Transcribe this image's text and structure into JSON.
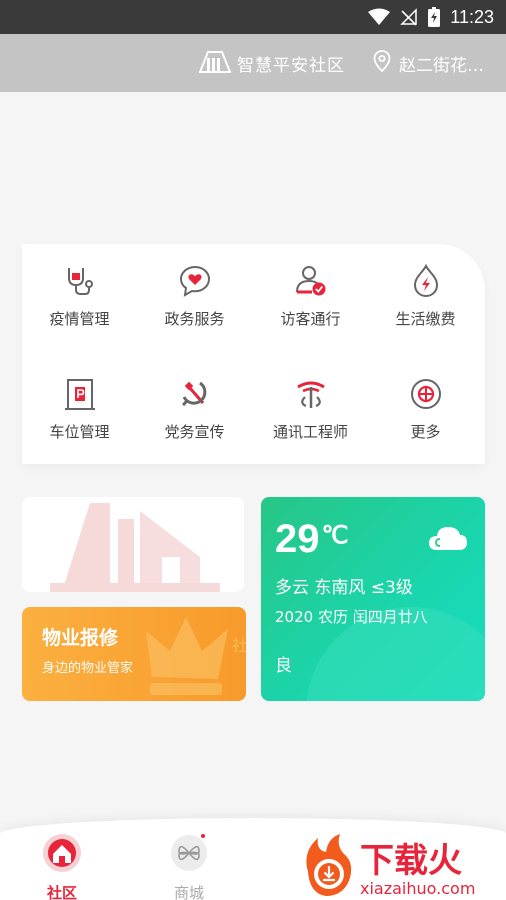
{
  "status_bar": {
    "time": "11:23"
  },
  "header": {
    "brand": "智慧平安社区",
    "location": "赵二街花…"
  },
  "services": [
    {
      "label": "疫情管理",
      "icon": "stethoscope-icon"
    },
    {
      "label": "政务服务",
      "icon": "heart-chat-icon"
    },
    {
      "label": "访客通行",
      "icon": "visitor-check-icon"
    },
    {
      "label": "生活缴费",
      "icon": "flame-drop-icon"
    },
    {
      "label": "车位管理",
      "icon": "parking-icon"
    },
    {
      "label": "党务宣传",
      "icon": "party-emblem-icon"
    },
    {
      "label": "通讯工程师",
      "icon": "telecom-icon"
    },
    {
      "label": "更多",
      "icon": "more-icon"
    }
  ],
  "repair": {
    "title": "物业报修",
    "subtitle": "身边的物业管家"
  },
  "weather": {
    "temp": "29",
    "unit": "℃",
    "desc": "多云 东南风 ≤3级",
    "date": "2020 农历 闰四月廿八",
    "air_quality": "良"
  },
  "bottom_nav": [
    {
      "label": "社区",
      "active": true
    },
    {
      "label": "商城",
      "active": false
    }
  ],
  "watermark": {
    "text": "下载火",
    "url_text": "xiazaihuo.com"
  },
  "colors": {
    "accent": "#e8243a",
    "weather_green": "#1ad6ae",
    "repair_orange": "#f79a2b"
  }
}
